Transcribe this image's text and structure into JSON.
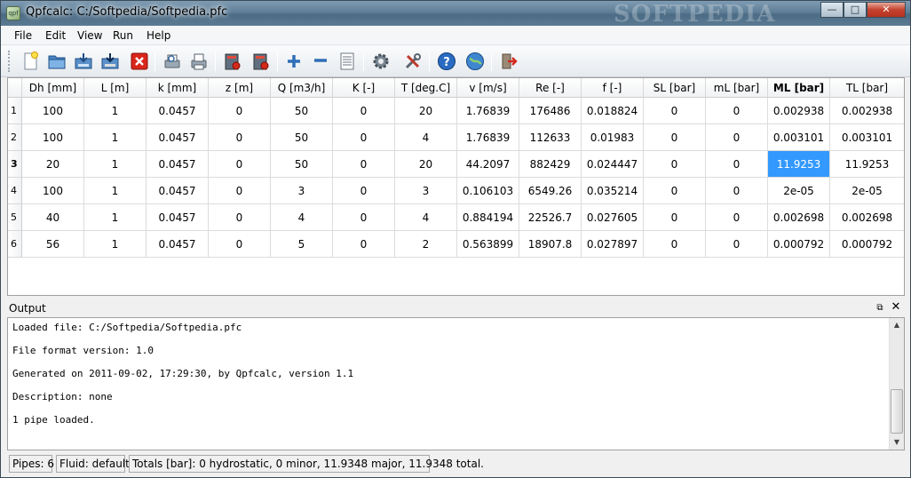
{
  "window": {
    "title": "Qpfcalc: C:/Softpedia/Softpedia.pfc",
    "watermark": "SOFTPEDIA",
    "app_icon_text": "qpf",
    "min_glyph": "—",
    "max_glyph": "□",
    "close_glyph": "✕"
  },
  "menu": [
    "File",
    "Edit",
    "View",
    "Run",
    "Help"
  ],
  "toolbar": {
    "icons": [
      "new-file-icon",
      "open-folder-icon",
      "save-icon",
      "save-as-icon",
      "close-file-icon",
      "print-preview-icon",
      "print-icon",
      "import-icon",
      "export-icon",
      "add-pipe-icon",
      "remove-pipe-icon",
      "list-icon",
      "settings-gear-icon",
      "tools-icon",
      "help-icon",
      "about-globe-icon",
      "exit-icon"
    ]
  },
  "table": {
    "headers": [
      "Dh [mm]",
      "L [m]",
      "k [mm]",
      "z [m]",
      "Q [m3/h]",
      "K [-]",
      "T [deg.C]",
      "v [m/s]",
      "Re [-]",
      "f [-]",
      "SL [bar]",
      "mL [bar]",
      "ML [bar]",
      "TL [bar]"
    ],
    "bold_header_index": 12,
    "rows": [
      {
        "num": "1",
        "cells": [
          "100",
          "1",
          "0.0457",
          "0",
          "50",
          "0",
          "20",
          "1.76839",
          "176486",
          "0.018824",
          "0",
          "0",
          "0.002938",
          "0.002938"
        ]
      },
      {
        "num": "2",
        "cells": [
          "100",
          "1",
          "0.0457",
          "0",
          "50",
          "0",
          "4",
          "1.76839",
          "112633",
          "0.01983",
          "0",
          "0",
          "0.003101",
          "0.003101"
        ]
      },
      {
        "num": "3",
        "cells": [
          "20",
          "1",
          "0.0457",
          "0",
          "50",
          "0",
          "20",
          "44.2097",
          "882429",
          "0.024447",
          "0",
          "0",
          "11.9253",
          "11.9253"
        ]
      },
      {
        "num": "4",
        "cells": [
          "100",
          "1",
          "0.0457",
          "0",
          "3",
          "0",
          "3",
          "0.106103",
          "6549.26",
          "0.035214",
          "0",
          "0",
          "2e-05",
          "2e-05"
        ]
      },
      {
        "num": "5",
        "cells": [
          "40",
          "1",
          "0.0457",
          "0",
          "4",
          "0",
          "4",
          "0.884194",
          "22526.7",
          "0.027605",
          "0",
          "0",
          "0.002698",
          "0.002698"
        ]
      },
      {
        "num": "6",
        "cells": [
          "56",
          "1",
          "0.0457",
          "0",
          "5",
          "0",
          "2",
          "0.563899",
          "18907.8",
          "0.027897",
          "0",
          "0",
          "0.000792",
          "0.000792"
        ]
      }
    ],
    "selected": {
      "row": 2,
      "col": 12
    }
  },
  "output": {
    "title": "Output",
    "float_glyph": "⧉",
    "close_glyph": "✕",
    "lines": [
      "Loaded file: C:/Softpedia/Softpedia.pfc",
      "File format version: 1.0",
      "Generated on 2011-09-02, 17:29:30, by Qpfcalc, version 1.1",
      "Description: none",
      "1 pipe loaded."
    ]
  },
  "status": {
    "pipes": "Pipes: 6",
    "fluid": "Fluid: default",
    "totals": "Totals [bar]: 0 hydrostatic, 0 minor, 11.9348 major, 11.9348 total."
  },
  "colors": {
    "selection": "#3399ff",
    "close_button": "#c4422e",
    "titlebar": "#5f7f98"
  }
}
